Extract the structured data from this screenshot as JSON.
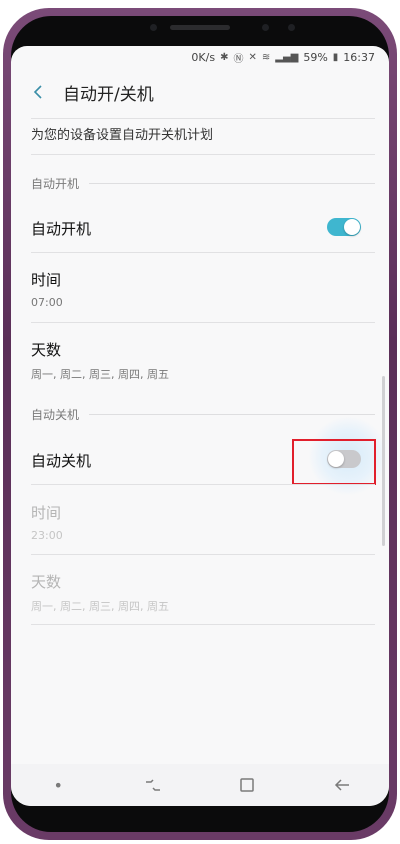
{
  "status_bar": {
    "speed": "0K/s",
    "battery": "59%",
    "time": "16:37"
  },
  "header": {
    "title": "自动开/关机"
  },
  "description": "为您的设备设置自动开关机计划",
  "auto_on": {
    "section_label": "自动开机",
    "toggle_label": "自动开机",
    "toggle_on": true,
    "time_label": "时间",
    "time_value": "07:00",
    "days_label": "天数",
    "days_value": "周一, 周二, 周三, 周四, 周五"
  },
  "auto_off": {
    "section_label": "自动关机",
    "toggle_label": "自动关机",
    "toggle_on": false,
    "time_label": "时间",
    "time_value": "23:00",
    "days_label": "天数",
    "days_value": "周一, 周二, 周三, 周四, 周五"
  },
  "colors": {
    "toggle_on": "#3fb6cf",
    "toggle_off": "#c9c9cc",
    "highlight": "#e11f2c"
  },
  "icons": [
    "back-arrow-icon",
    "bluetooth-icon",
    "nfc-icon",
    "mute-icon",
    "wifi-icon",
    "signal-icon",
    "battery-icon",
    "dot-icon",
    "recents-icon",
    "home-icon",
    "nav-back-icon"
  ]
}
